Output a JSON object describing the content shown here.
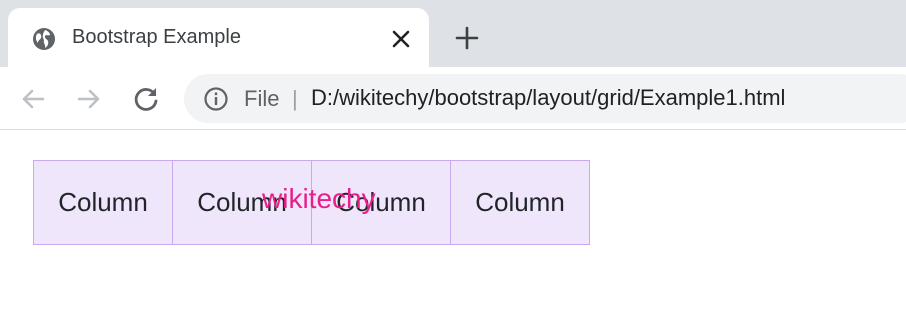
{
  "browser": {
    "tab": {
      "title": "Bootstrap Example",
      "icon": "globe-icon"
    },
    "toolbar": {
      "back_icon": "back-arrow-icon",
      "forward_icon": "forward-arrow-icon",
      "reload_icon": "reload-icon",
      "info_icon": "info-icon",
      "scheme_label": "File",
      "separator": "|",
      "url": "D:/wikitechy/bootstrap/layout/grid/Example1.html"
    },
    "colors": {
      "tabstrip": "#dee1e6",
      "omnibox": "#f1f3f4",
      "column_bg": "#f0e6fb",
      "column_border": "#c9aaf0",
      "watermark": "#e91e8c"
    }
  },
  "page": {
    "columns": [
      {
        "label": "Column"
      },
      {
        "label": "Column"
      },
      {
        "label": "Column"
      },
      {
        "label": "Column"
      }
    ],
    "watermark": "wikitechy"
  }
}
